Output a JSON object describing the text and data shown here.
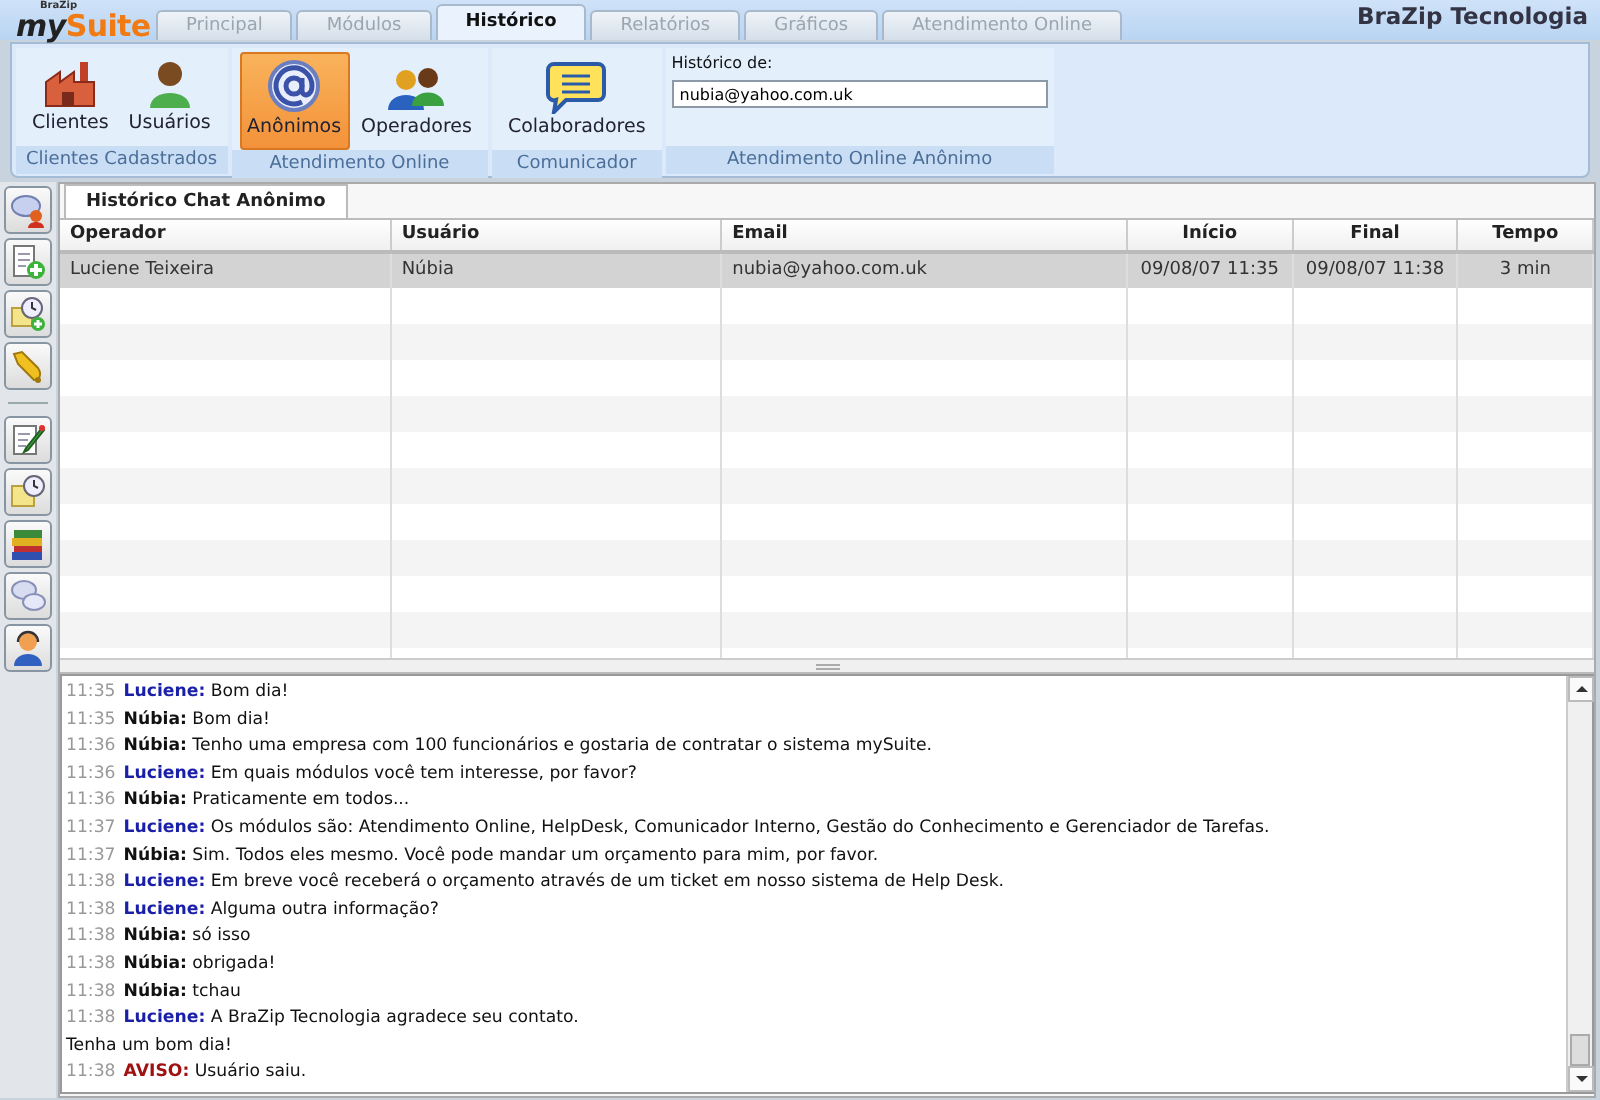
{
  "logo": {
    "maker": "BraZip",
    "lead": "my",
    "accent": "Suite"
  },
  "tabs": [
    {
      "label": "Principal",
      "selected": false
    },
    {
      "label": "Módulos",
      "selected": false
    },
    {
      "label": "Histórico",
      "selected": true
    },
    {
      "label": "Relatórios",
      "selected": false
    },
    {
      "label": "Gráficos",
      "selected": false
    },
    {
      "label": "Atendimento Online",
      "selected": false
    }
  ],
  "company": "BraZip Tecnologia",
  "ribbon": {
    "groups": [
      {
        "label": "Clientes Cadastrados",
        "buttons": [
          {
            "label": "Clientes",
            "selected": false
          },
          {
            "label": "Usuários",
            "selected": false
          }
        ]
      },
      {
        "label": "Atendimento Online",
        "buttons": [
          {
            "label": "Anônimos",
            "selected": true
          },
          {
            "label": "Operadores",
            "selected": false
          }
        ]
      },
      {
        "label": "Comunicador",
        "buttons": [
          {
            "label": "Colaboradores",
            "selected": false
          }
        ]
      }
    ],
    "search": {
      "group_label": "Atendimento Online Anônimo",
      "label": "Histórico de:",
      "value": "nubia@yahoo.com.uk"
    }
  },
  "content_tab": {
    "label": "Histórico Chat Anônimo",
    "selected": true
  },
  "table": {
    "columns": [
      "Operador",
      "Usuário",
      "Email",
      "Início",
      "Final",
      "Tempo"
    ],
    "rows": [
      {
        "cells": [
          "Luciene Teixeira",
          "Núbia",
          "nubia@yahoo.com.uk",
          "09/08/07 11:35",
          "09/08/07 11:38",
          "3 min"
        ],
        "selected": true
      }
    ]
  },
  "chat": [
    {
      "kind": "operator",
      "time": "11:35",
      "sender": "Luciene:",
      "text": "Bom dia!"
    },
    {
      "kind": "visitor",
      "time": "11:35",
      "sender": "Núbia:",
      "text": "Bom dia!"
    },
    {
      "kind": "visitor",
      "time": "11:36",
      "sender": "Núbia:",
      "text": "Tenho uma empresa com 100 funcionários e gostaria de contratar o sistema mySuite."
    },
    {
      "kind": "operator",
      "time": "11:36",
      "sender": "Luciene:",
      "text": "Em quais módulos você tem interesse, por favor?"
    },
    {
      "kind": "visitor",
      "time": "11:36",
      "sender": "Núbia:",
      "text": "Praticamente em todos..."
    },
    {
      "kind": "operator",
      "time": "11:37",
      "sender": "Luciene:",
      "text": "Os módulos são: Atendimento Online, HelpDesk, Comunicador Interno, Gestão do Conhecimento e Gerenciador de Tarefas."
    },
    {
      "kind": "visitor",
      "time": "11:37",
      "sender": "Núbia:",
      "text": "Sim. Todos eles mesmo. Você pode mandar um orçamento para mim, por favor."
    },
    {
      "kind": "operator",
      "time": "11:38",
      "sender": "Luciene:",
      "text": "Em breve você receberá o orçamento através de um ticket em nosso sistema de Help Desk."
    },
    {
      "kind": "operator",
      "time": "11:38",
      "sender": "Luciene:",
      "text": "Alguma outra informação?"
    },
    {
      "kind": "visitor",
      "time": "11:38",
      "sender": "Núbia:",
      "text": "só isso"
    },
    {
      "kind": "visitor",
      "time": "11:38",
      "sender": "Núbia:",
      "text": "obrigada!"
    },
    {
      "kind": "visitor",
      "time": "11:38",
      "sender": "Núbia:",
      "text": "tchau"
    },
    {
      "kind": "operator",
      "time": "11:38",
      "sender": "Luciene:",
      "text": "A BraZip Tecnologia agradece seu contato."
    },
    {
      "kind": "continuation",
      "text": "Tenha um bom dia!"
    },
    {
      "kind": "notice",
      "time": "11:38",
      "sender": "AVISO:",
      "text": "Usuário saiu."
    }
  ]
}
